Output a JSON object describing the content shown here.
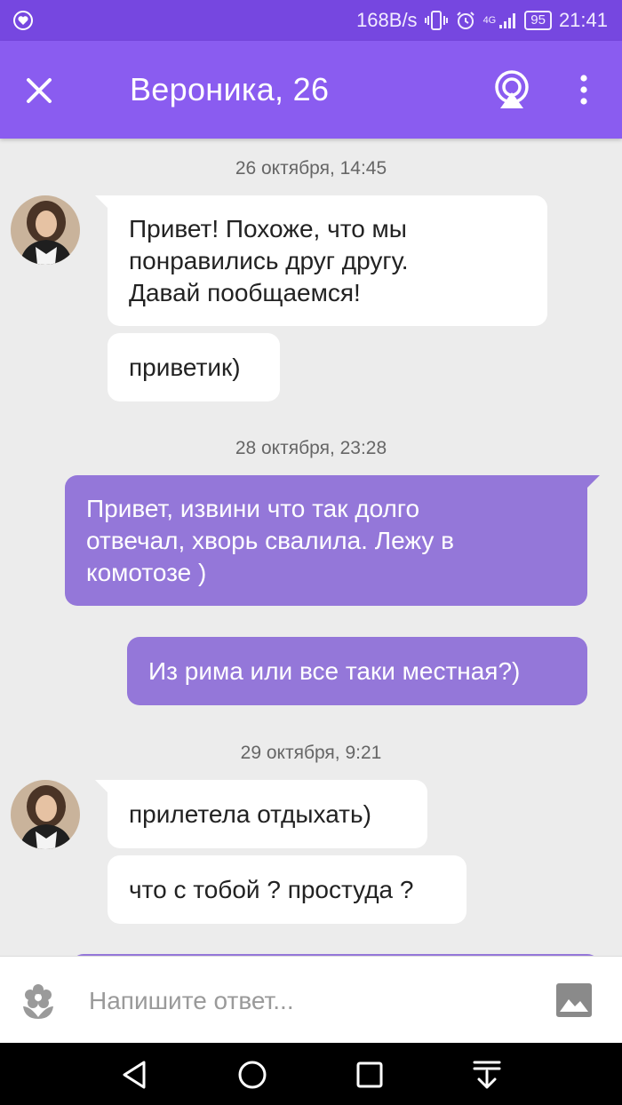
{
  "status_bar": {
    "speed": "168B/s",
    "network": "4G",
    "battery": "95",
    "time": "21:41"
  },
  "header": {
    "title": "Вероника, 26"
  },
  "chat": {
    "dates": [
      "26 октября, 14:45",
      "28 октября, 23:28",
      "29 октября, 9:21"
    ],
    "messages": [
      {
        "from": "in",
        "text": "Привет! Похоже, что мы\nпонравились друг другу.\nДавай пообщаемся!"
      },
      {
        "from": "in",
        "text": "приветик)"
      },
      {
        "from": "out",
        "text": "Привет, извини что так долго\nотвечал, хворь свалила. Лежу в\nкомотозе )"
      },
      {
        "from": "out",
        "text": "Из рима или все таки местная?)"
      },
      {
        "from": "in",
        "text": "прилетела отдыхать)"
      },
      {
        "from": "in",
        "text": "что с тобой ? простуда ?"
      }
    ]
  },
  "composer": {
    "placeholder": "Напишите ответ..."
  },
  "colors": {
    "status_bar": "#7647e0",
    "app_bar": "#8a5cf0",
    "outgoing_bubble": "#9477d9",
    "incoming_bubble": "#ffffff",
    "background": "#ececec"
  },
  "icons": {
    "status": [
      "heart-icon",
      "vibrate-icon",
      "alarm-icon",
      "signal-icon",
      "battery-icon"
    ],
    "header": [
      "close-icon",
      "live-stream-icon",
      "more-vert-icon"
    ],
    "composer": [
      "flower-sticker-icon",
      "image-attach-icon"
    ],
    "navigation": [
      "back-icon",
      "home-icon",
      "recents-icon",
      "notification-shade-icon"
    ]
  }
}
